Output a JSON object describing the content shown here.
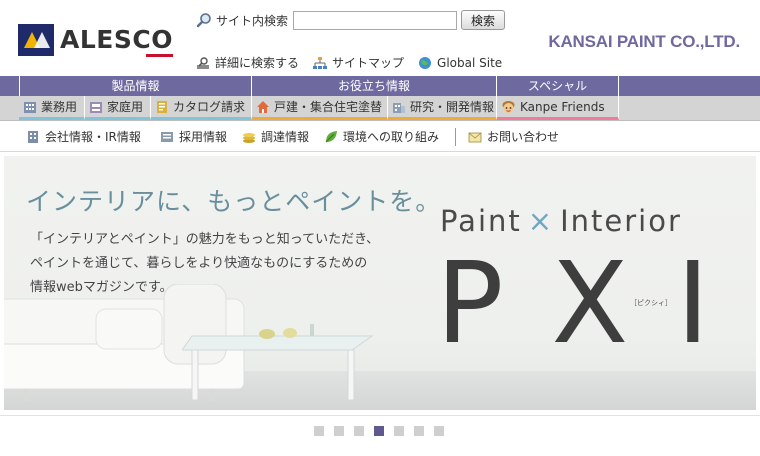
{
  "header": {
    "logo_text": "ALESCO",
    "brand_text": "KANSAI PAINT CO.,LTD.",
    "search_label": "サイト内検索",
    "search_value": "",
    "search_button": "検索",
    "util_links": [
      {
        "label": "詳細に検索する",
        "icon": "advanced-search-icon"
      },
      {
        "label": "サイトマップ",
        "icon": "sitemap-icon"
      },
      {
        "label": "Global Site",
        "icon": "globe-icon"
      }
    ]
  },
  "nav": {
    "categories": [
      "製品情報",
      "お役立ち情報",
      "スペシャル"
    ],
    "items": [
      {
        "label": "業務用",
        "icon": "building-icon"
      },
      {
        "label": "家庭用",
        "icon": "home-icon"
      },
      {
        "label": "カタログ請求",
        "icon": "catalog-icon"
      },
      {
        "label": "戸建・集合住宅塗替",
        "icon": "house-icon"
      },
      {
        "label": "研究・開発情報",
        "icon": "research-icon"
      },
      {
        "label": "Kanpe Friends",
        "icon": "mascot-icon"
      }
    ],
    "sub_items": [
      {
        "label": "会社情報・IR情報",
        "icon": "office-icon"
      },
      {
        "label": "採用情報",
        "icon": "recruit-icon"
      },
      {
        "label": "調達情報",
        "icon": "coins-icon"
      },
      {
        "label": "環境への取り組み",
        "icon": "leaf-icon"
      },
      {
        "label": "お問い合わせ",
        "icon": "mail-icon"
      }
    ]
  },
  "hero": {
    "heading": "インテリアに、もっとペイントを。",
    "body_lines": [
      "「インテリアとペイント」の魅力をもっと知っていただき、",
      "ペイントを通じて、暮らしをより快適なものにするための",
      "情報webマガジンです。"
    ],
    "title_left": "Paint",
    "title_x": "×",
    "title_right": "Interior",
    "big_text": "PXI",
    "ruby": "［ピクシィ］"
  },
  "carousel": {
    "total": 7,
    "active_index": 3
  },
  "colors": {
    "nav_purple": "#6e6aa0",
    "accent_red": "#c8102e",
    "hero_teal": "#6a8f9c"
  }
}
